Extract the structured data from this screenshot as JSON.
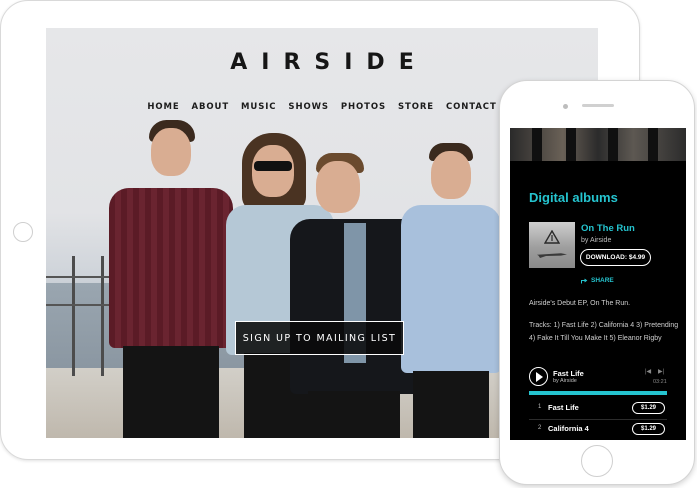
{
  "site": {
    "logo": "AIRSIDE",
    "nav": [
      "HOME",
      "ABOUT",
      "MUSIC",
      "SHOWS",
      "PHOTOS",
      "STORE",
      "CONTACT"
    ],
    "cta_label": "SIGN UP TO MAILING LIST"
  },
  "mobile": {
    "section_title": "Digital albums",
    "album": {
      "name": "On The Run",
      "artist": "by Airside",
      "download_label": "DOWNLOAD: $4.99",
      "share_label": "SHARE",
      "description": "Airside's Debut EP, On The Run.",
      "tracklist_text": "Tracks: 1) Fast Life 2) California 4 3) Pretending 4) Fake It Till You Make It 5) Eleanor Rigby"
    },
    "player": {
      "track": "Fast Life",
      "artist": "by Airside",
      "time": "03:21",
      "progress": 1.0
    },
    "tracks": [
      {
        "num": "1",
        "name": "Fast Life",
        "price": "$1.29"
      },
      {
        "num": "2",
        "name": "California 4",
        "price": "$1.29"
      }
    ]
  },
  "colors": {
    "accent": "#25c4cf",
    "tablet_bg": "#ffffff",
    "phone_screen_bg": "#000000"
  },
  "icons": {
    "share": "share-icon",
    "play": "play-icon",
    "prev": "skip-back-icon",
    "next": "skip-forward-icon"
  }
}
